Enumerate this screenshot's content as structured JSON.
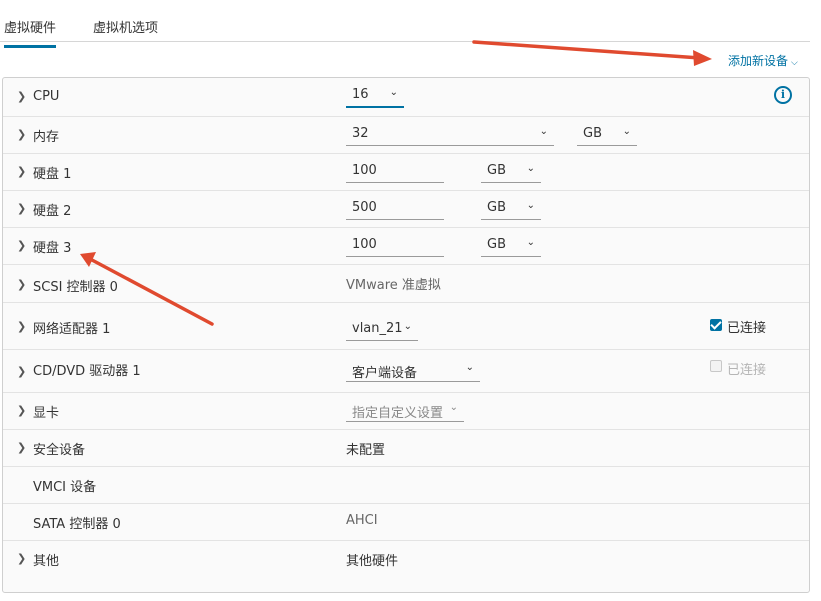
{
  "tabs": [
    {
      "label": "虚拟硬件",
      "active": true
    },
    {
      "label": "虚拟机选项",
      "active": false
    }
  ],
  "add_device": {
    "label": "添加新设备",
    "icon": "chevron-down-icon"
  },
  "accent_color": "#0072a3",
  "annotation_color": "#e04a2f",
  "hardware": {
    "cpu": {
      "label": "CPU",
      "value": "16"
    },
    "memory": {
      "label": "内存",
      "value": "32",
      "unit": "GB"
    },
    "disk1": {
      "label": "硬盘 1",
      "value": "100",
      "unit": "GB"
    },
    "disk2": {
      "label": "硬盘 2",
      "value": "500",
      "unit": "GB"
    },
    "disk3": {
      "label": "硬盘 3",
      "value": "100",
      "unit": "GB"
    },
    "scsi": {
      "label": "SCSI 控制器 0",
      "value": "VMware 准虚拟"
    },
    "network": {
      "label": "网络适配器 1",
      "value": "vlan_21",
      "connected_label": "已连接",
      "connected": true
    },
    "cdrom": {
      "label": "CD/DVD 驱动器 1",
      "value": "客户端设备",
      "connected_label": "已连接",
      "connected": false
    },
    "video": {
      "label": "显卡",
      "value": "指定自定义设置"
    },
    "security": {
      "label": "安全设备",
      "value": "未配置"
    },
    "vmci": {
      "label": "VMCI 设备"
    },
    "sata": {
      "label": "SATA 控制器 0",
      "value": "AHCI"
    },
    "other": {
      "label": "其他",
      "value": "其他硬件"
    }
  }
}
